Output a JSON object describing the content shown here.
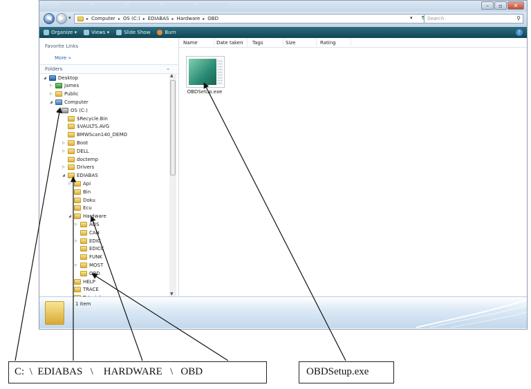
{
  "window": {
    "address": {
      "crumbs": [
        "Computer",
        "OS (C:)",
        "EDIABAS",
        "Hardware",
        "OBD"
      ],
      "separator": "▸",
      "search_placeholder": "Search"
    },
    "toolbar": {
      "items": [
        {
          "label": "Organize ▾",
          "icon": "organize-icon"
        },
        {
          "label": "Views ▾",
          "icon": "views-icon"
        },
        {
          "label": "Slide Show",
          "icon": "slideshow-icon"
        },
        {
          "label": "Burn",
          "icon": "burn-icon"
        }
      ]
    },
    "nav_pane": {
      "favorites_header": "Favorite Links",
      "more_label": "More  »",
      "folders_header": "Folders",
      "tree": [
        {
          "label": "Desktop",
          "depth": 0,
          "twisty": "◢",
          "icon": "desktop"
        },
        {
          "label": "James",
          "depth": 1,
          "twisty": "▷",
          "icon": "user"
        },
        {
          "label": "Public",
          "depth": 1,
          "twisty": "▷",
          "icon": "folder"
        },
        {
          "label": "Computer",
          "depth": 1,
          "twisty": "◢",
          "icon": "computer"
        },
        {
          "label": "OS (C:)",
          "depth": 2,
          "twisty": "◢",
          "icon": "drive"
        },
        {
          "label": "$Recycle.Bin",
          "depth": 3,
          "twisty": "",
          "icon": "folder"
        },
        {
          "label": "$VAULTS.AVG",
          "depth": 3,
          "twisty": "",
          "icon": "folder"
        },
        {
          "label": "BMWScan140_DEMO",
          "depth": 3,
          "twisty": "",
          "icon": "folder"
        },
        {
          "label": "Boot",
          "depth": 3,
          "twisty": "▷",
          "icon": "folder"
        },
        {
          "label": "DELL",
          "depth": 3,
          "twisty": "▷",
          "icon": "folder"
        },
        {
          "label": "doctemp",
          "depth": 3,
          "twisty": "",
          "icon": "folder"
        },
        {
          "label": "Drivers",
          "depth": 3,
          "twisty": "▷",
          "icon": "folder"
        },
        {
          "label": "EDIABAS",
          "depth": 3,
          "twisty": "◢",
          "icon": "folder"
        },
        {
          "label": "Api",
          "depth": 4,
          "twisty": "▷",
          "icon": "folder"
        },
        {
          "label": "Bin",
          "depth": 4,
          "twisty": "",
          "icon": "folder"
        },
        {
          "label": "Doku",
          "depth": 4,
          "twisty": "",
          "icon": "folder"
        },
        {
          "label": "Ecu",
          "depth": 4,
          "twisty": "",
          "icon": "folder"
        },
        {
          "label": "Hardware",
          "depth": 4,
          "twisty": "◢",
          "icon": "folder"
        },
        {
          "label": "ADS",
          "depth": 5,
          "twisty": "▷",
          "icon": "folder"
        },
        {
          "label": "CAN",
          "depth": 5,
          "twisty": "",
          "icon": "folder"
        },
        {
          "label": "EDIC",
          "depth": 5,
          "twisty": "▷",
          "icon": "folder"
        },
        {
          "label": "EDICC",
          "depth": 5,
          "twisty": "",
          "icon": "folder"
        },
        {
          "label": "FUNK",
          "depth": 5,
          "twisty": "",
          "icon": "folder"
        },
        {
          "label": "MOST",
          "depth": 5,
          "twisty": "▷",
          "icon": "folder"
        },
        {
          "label": "OBD",
          "depth": 5,
          "twisty": "",
          "icon": "folder"
        },
        {
          "label": "HELP",
          "depth": 4,
          "twisty": "",
          "icon": "folder"
        },
        {
          "label": "TRACE",
          "depth": 4,
          "twisty": "",
          "icon": "folder"
        },
        {
          "label": "Tutorial",
          "depth": 4,
          "twisty": "",
          "icon": "folder"
        }
      ]
    },
    "columns": [
      "Name",
      "Date taken",
      "Tags",
      "Size",
      "Rating"
    ],
    "files": [
      {
        "name": "OBDSetup.exe"
      }
    ],
    "details": {
      "count": "1 item"
    }
  },
  "annotations": {
    "path_label": "C:  \\  EDIABAS   \\    HARDWARE   \\   OBD",
    "file_label": "OBDSetup.exe"
  },
  "colors": {
    "toolbar": "#1f5d6c",
    "address_bg": "#c9d9ea",
    "link": "#2a63b5"
  }
}
